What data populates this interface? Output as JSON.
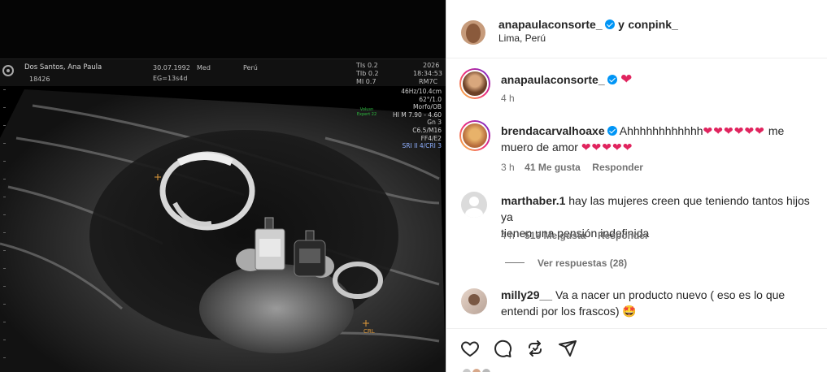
{
  "ultrasound": {
    "patient_name": "Dos Santos, Ana Paula",
    "patient_id": "18426",
    "date": "30.07.1992",
    "ga_label": "EG=13s4d",
    "mode": "Med",
    "location": "Perú",
    "indices": [
      "TIs 0.2",
      "TIb 0.2",
      "MI 0.7"
    ],
    "year": "2026",
    "time": "18:34:53",
    "probe": "RM7C",
    "params": [
      "46Hz/10.4cm",
      "62°/1.0",
      "Morfo/OB",
      "HI M 7.90 - 4.60",
      "Gn 3",
      "C6.5/M16",
      "FF4/E2"
    ],
    "param_blue": "SRI II 4/CRI 3",
    "green_label": "Volusn Expert 22",
    "crl_label": "CRL"
  },
  "post": {
    "author": "anapaulaconsorte_",
    "joiner": "y",
    "collaborator": "conpink_",
    "location": "Lima, Perú"
  },
  "caption": {
    "username": "anapaulaconsorte_",
    "emoji": "❤",
    "time": "4 h"
  },
  "comments": [
    {
      "username": "brendacarvalhoaxe",
      "text_line1": "Ahhhhhhhhhhhh",
      "hearts_line1": "❤❤❤❤❤❤",
      "text_mid": "me",
      "text_line2": "muero de amor",
      "hearts_line2": "❤❤❤❤❤",
      "time": "3 h",
      "likes": "41 Me gusta",
      "reply": "Responder"
    },
    {
      "username": "marthaber.1",
      "text_line1": "hay las mujeres creen que teniendo tantos hijos ya",
      "text_line2": "tienen una pensión indefinida",
      "time": "4 h",
      "likes": "516 Me gusta",
      "reply": "Responder",
      "view_replies": "Ver respuestas (28)"
    },
    {
      "username": "milly29__",
      "text_line1": "Va a nacer un producto nuevo ( eso es lo que",
      "text_line2": "entendi por los frascos)",
      "emoji": "🤩"
    }
  ],
  "actions": {
    "like_icon": "heart-icon",
    "comment_icon": "comment-icon",
    "repost_icon": "repost-icon",
    "share_icon": "share-icon"
  },
  "colors": {
    "verified": "#0095f6",
    "heart": "#e0245e",
    "text": "#262626",
    "muted": "#737373",
    "story_ring": "#ee2a7b"
  }
}
